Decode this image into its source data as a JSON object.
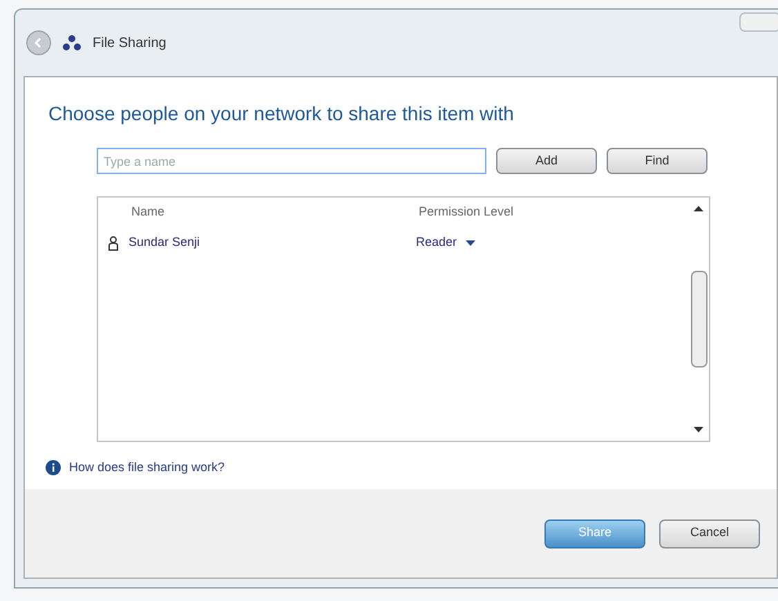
{
  "window": {
    "title": "File Sharing"
  },
  "heading": "Choose people on your network to share this item with",
  "name_field": {
    "placeholder": "Type a name"
  },
  "buttons_top": [
    "Add",
    "Find"
  ],
  "table": {
    "columns": [
      "Name",
      "Permission Level"
    ],
    "rows": [
      {
        "name": "Sundar Senji",
        "permission": "Reader"
      }
    ]
  },
  "help_link": "How does file sharing work?",
  "buttons": [
    {
      "label": "Share",
      "default": true
    },
    {
      "label": "Cancel",
      "default": false
    }
  ]
}
